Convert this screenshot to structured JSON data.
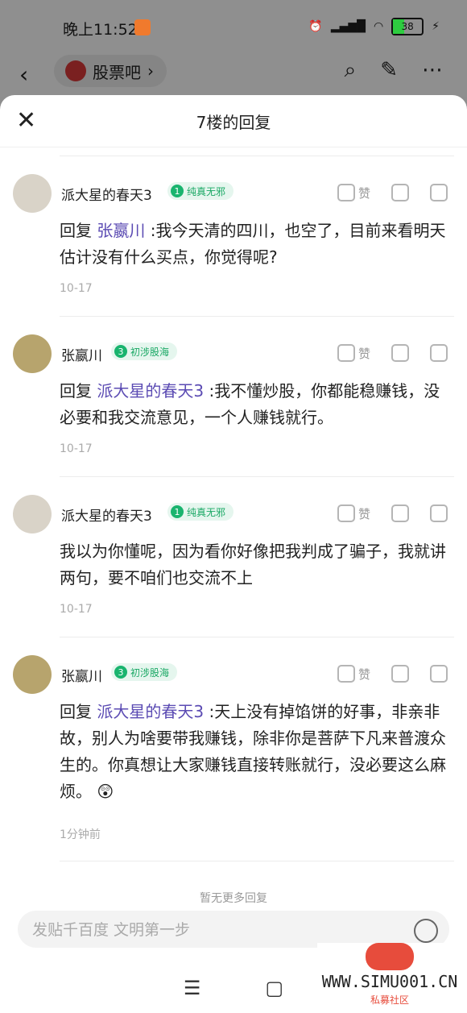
{
  "status_bar": {
    "time": "晚上11:52",
    "battery": "38",
    "battery_level": 0.38
  },
  "nav": {
    "back_icon": "chevron-left-icon",
    "forum_name": "股票吧",
    "icons": [
      "search-icon",
      "edit-icon",
      "more-icon"
    ]
  },
  "sheet": {
    "title": "7楼的回复"
  },
  "posts": [
    {
      "username": "派大星的春天3",
      "badge_level": "1",
      "badge_text": "纯真无邪",
      "like_label": "赞",
      "reply_to": "张嬴川",
      "prefix": "回复",
      "text": ":我今天清的四川，也空了，目前来看明天估计没有什么买点，你觉得呢?",
      "date": "10-17",
      "avatar": "cat-avatar"
    },
    {
      "username": "张嬴川",
      "badge_level": "3",
      "badge_text": "初涉股海",
      "like_label": "赞",
      "reply_to": "派大星的春天3",
      "prefix": "回复",
      "text": ":我不懂炒股，你都能稳赚钱，没必要和我交流意见，一个人赚钱就行。",
      "date": "10-17",
      "avatar": "anime-avatar"
    },
    {
      "username": "派大星的春天3",
      "badge_level": "1",
      "badge_text": "纯真无邪",
      "like_label": "赞",
      "reply_to": "",
      "prefix": "",
      "text": "我以为你懂呢，因为看你好像把我判成了骗子，我就讲两句，要不咱们也交流不上",
      "date": "10-17",
      "avatar": "cat-avatar"
    },
    {
      "username": "张嬴川",
      "badge_level": "3",
      "badge_text": "初涉股海",
      "like_label": "赞",
      "reply_to": "派大星的春天3",
      "prefix": "回复",
      "text": ":天上没有掉馅饼的好事，非亲非故，别人为啥要带我赚钱，除非你是菩萨下凡来普渡众生的。你真想让大家赚钱直接转账就行，没必要这么麻烦。",
      "date": "1分钟前",
      "avatar": "anime-avatar"
    }
  ],
  "no_more": "暂无更多回复",
  "input": {
    "placeholder": "发贴千百度 文明第一步"
  },
  "bottom_nav": {
    "icons": [
      "menu-icon",
      "home-icon"
    ]
  },
  "watermark": {
    "text": "WWW.SIMU001.CN",
    "sub": "私募社区"
  },
  "colors": {
    "accent": "#5b4bb3",
    "badge_green": "#19a864"
  }
}
